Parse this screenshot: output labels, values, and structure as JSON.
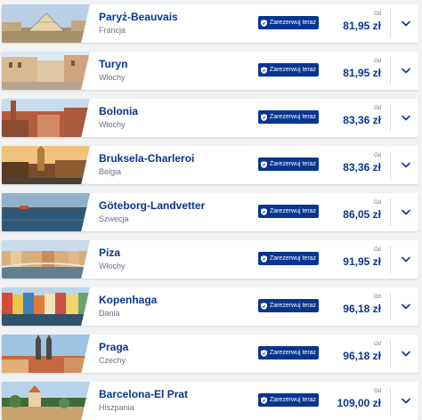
{
  "book_label": "Zarezerwuj teraz",
  "from_label": "Od",
  "colors": {
    "brand": "#073590",
    "background": "#f1f2f4"
  },
  "icons": {
    "book": "shield-icon",
    "expand": "chevron-down-icon"
  },
  "destinations": [
    {
      "city": "Paryż-Beauvais",
      "country": "Francja",
      "price": "81,95 zł"
    },
    {
      "city": "Turyn",
      "country": "Włochy",
      "price": "81,95 zł"
    },
    {
      "city": "Bolonia",
      "country": "Włochy",
      "price": "83,36 zł"
    },
    {
      "city": "Bruksela-Charleroi",
      "country": "Belgia",
      "price": "83,36 zł"
    },
    {
      "city": "Göteborg-Landvetter",
      "country": "Szwecja",
      "price": "86,05 zł"
    },
    {
      "city": "Piza",
      "country": "Włochy",
      "price": "91,95 zł"
    },
    {
      "city": "Kopenhaga",
      "country": "Dania",
      "price": "96,18 zł"
    },
    {
      "city": "Praga",
      "country": "Czechy",
      "price": "96,18 zł"
    },
    {
      "city": "Barcelona-El Prat",
      "country": "Hiszpania",
      "price": "109,00 zł"
    }
  ]
}
